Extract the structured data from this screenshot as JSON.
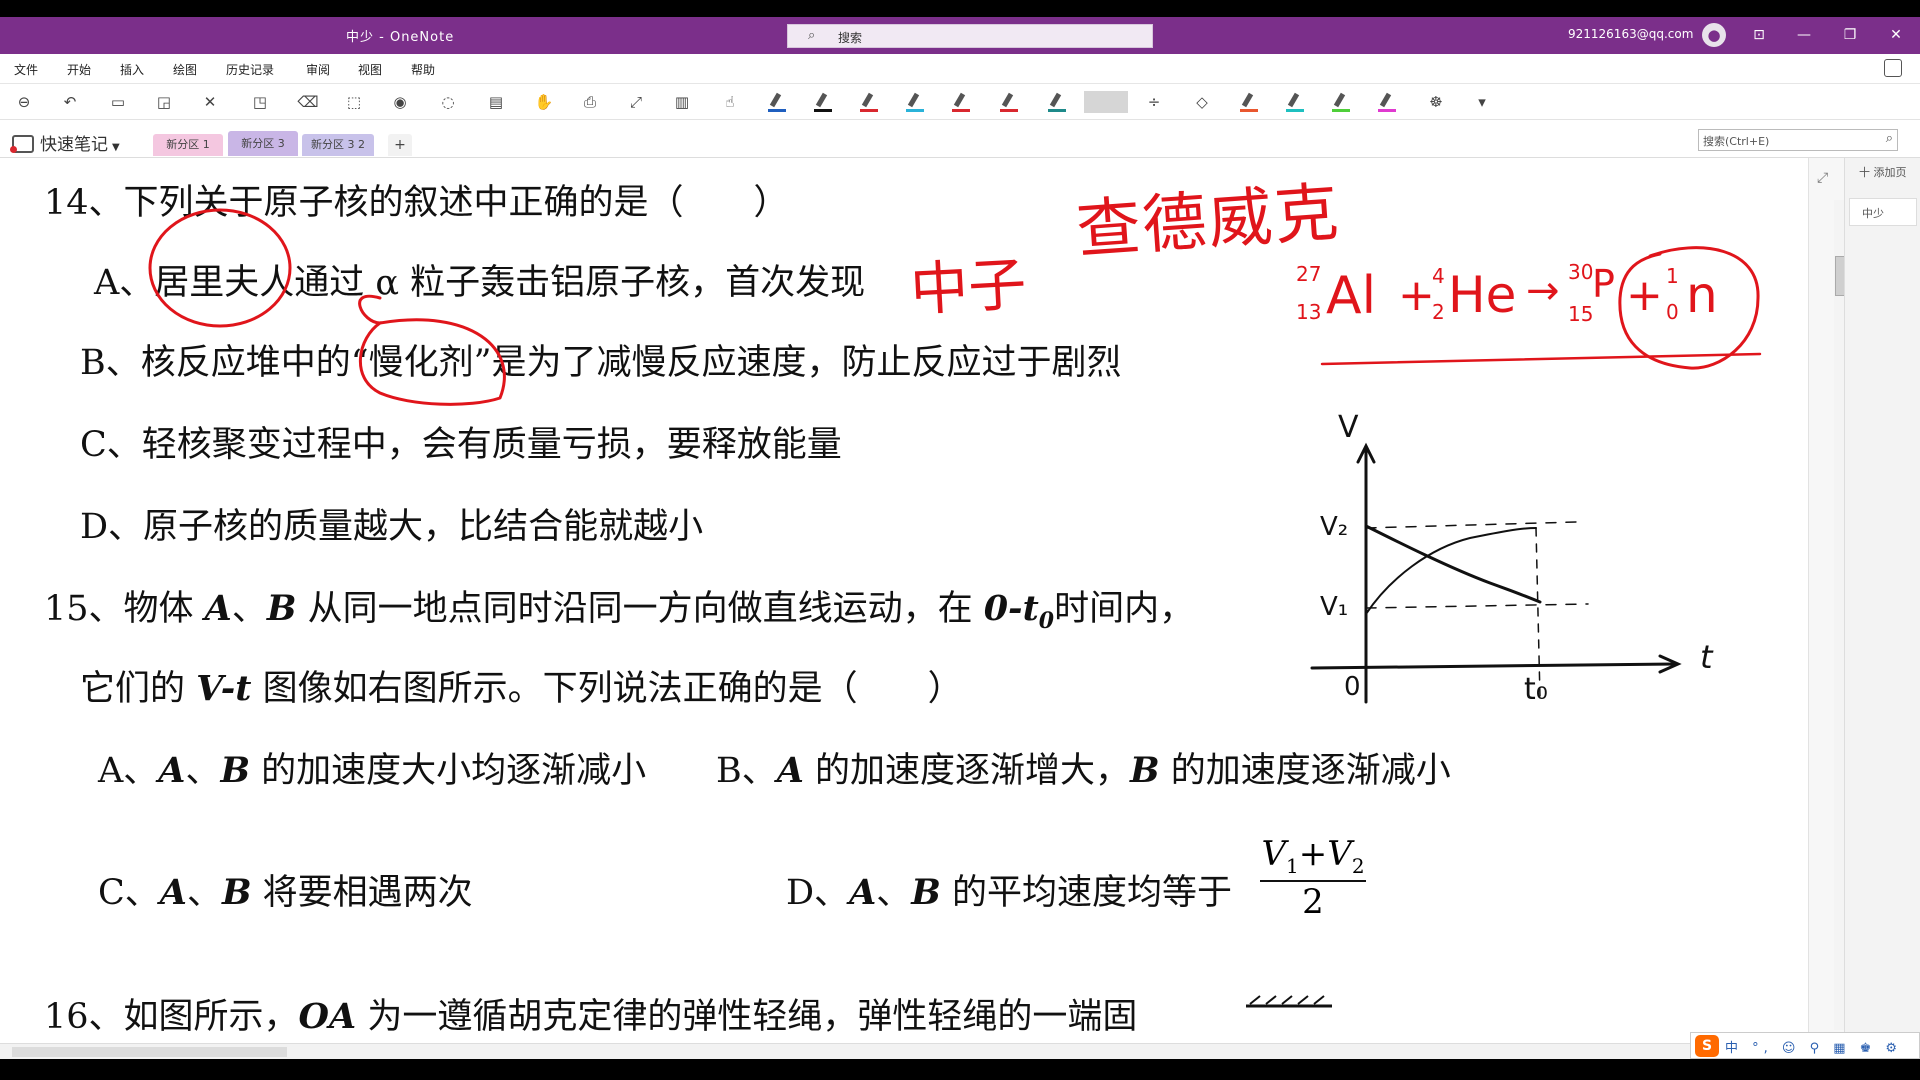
{
  "window": {
    "title": "中少  -  OneNote",
    "search_placeholder": "搜索",
    "account": "921126163@qq.com",
    "buttons": [
      "⊡",
      "—",
      "❐",
      "✕"
    ]
  },
  "menu": [
    "文件",
    "开始",
    "插入",
    "绘图",
    "历史记录",
    "审阅",
    "视图",
    "帮助"
  ],
  "toolbar": {
    "icons": [
      "back-icon",
      "undo-icon",
      "type-icon",
      "shapes-icon",
      "eraser-icon",
      "lasso-icon",
      "ruler-icon",
      "ink-to-shape-icon",
      "color-wheel-icon",
      "add-space-icon",
      "pan-icon",
      "math-icon",
      "ink-to-text-icon",
      "replay-icon",
      "touch-icon"
    ],
    "pen_colors": [
      "#1f5fbf",
      "#111111",
      "#d9282f",
      "#2ab3d9",
      "#d9282f",
      "#d9282f",
      "#1e8a8a",
      "#d9282f",
      "#e9572f",
      "#1ec0c0",
      "#4fcf3a",
      "#e03ad0",
      "#f1e21c"
    ]
  },
  "notebook": {
    "name": "快速笔记",
    "sections": [
      "新分区 1",
      "新分区 3",
      "新分区 3 2"
    ],
    "add_label": "+",
    "search_placeholder": "搜索(Ctrl+E)"
  },
  "pages_panel": {
    "add_page": "十 添加页",
    "pages": [
      "中少"
    ]
  },
  "document": {
    "q14": "14、下列关于原子核的叙述中正确的是（　　）",
    "q14_a": "A、居里夫人通过 α 粒子轰击铝原子核，首次发现",
    "q14_b": "B、核反应堆中的“慢化剂”是为了减慢反应速度，防止反应过于剧烈",
    "q14_c": "C、轻核聚变过程中，会有质量亏损，要释放能量",
    "q14_d": "D、原子核的质量越大，比结合能就越小",
    "q15_pre": "15、物体 ",
    "q15_A": "A",
    "q15_sep": "、",
    "q15_B": "B",
    "q15_mid": " 从同一地点同时沿同一方向做直线运动，在 ",
    "q15_t": "0-t",
    "q15_sub": "0",
    "q15_end": "时间内，",
    "q15_line2_pre": "它们的 ",
    "q15_vt": "V-t",
    "q15_line2_end": " 图像如右图所示。下列说法正确的是（　　）",
    "q15_a_prefix": "A、",
    "q15_a_text": " 的加速度大小均逐渐减小",
    "q15_b_prefix": "B、",
    "q15_b_mid": " 的加速度逐渐增大，",
    "q15_b_end": " 的加速度逐渐减小",
    "q15_c_prefix": "C、",
    "q15_c_text": " 将要相遇两次",
    "q15_d_prefix": "D、",
    "q15_d_text": " 的平均速度均等于",
    "q15_d_num_v1": "V",
    "q15_d_num_1": "1",
    "q15_d_plus": "+",
    "q15_d_num_v2": "V",
    "q15_d_num_2": "2",
    "q15_d_den": "2",
    "q16_pre": "16、如图所示，",
    "q16_oa": "OA",
    "q16_text": " 为一遵循胡克定律的弹性轻绳，弹性轻绳的一端固"
  },
  "ink": {
    "handwriting_top": "查德威克",
    "handwriting_neutron": "中子",
    "equation": {
      "al_mass": "27",
      "al_num": "13",
      "al": "Al",
      "plus1": "+",
      "he_mass": "4",
      "he_num": "2",
      "he": "He",
      "arrow": "→",
      "p_mass": "30",
      "p_num": "15",
      "p": "P",
      "plus2": "+",
      "n_mass": "1",
      "n_num": "0",
      "n": "n"
    },
    "graph": {
      "v_axis": "V",
      "t_axis": "t",
      "origin": "0",
      "v1": "V₁",
      "v2": "V₂",
      "t0": "t₀"
    },
    "ink_color": "#e0151b"
  },
  "ime": {
    "logo": "S",
    "items": "中 °, ☺ ⚲ ▦ ♚ ⚙"
  }
}
